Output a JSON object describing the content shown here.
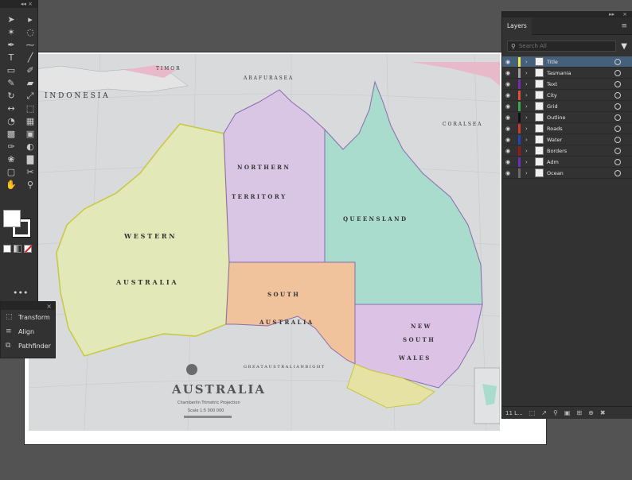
{
  "tools": {
    "panel_controls": "◂◂  ×",
    "icons": [
      "selection-icon",
      "direct-selection-icon",
      "magic-wand-icon",
      "lasso-icon",
      "pen-icon",
      "curvature-icon",
      "type-icon",
      "line-segment-icon",
      "rectangle-icon",
      "paintbrush-icon",
      "shaper-icon",
      "eraser-icon",
      "rotate-icon",
      "scale-icon",
      "width-icon",
      "free-transform-icon",
      "shape-builder-icon",
      "perspective-grid-icon",
      "mesh-icon",
      "gradient-icon",
      "eyedropper-icon",
      "blend-icon",
      "symbol-sprayer-icon",
      "column-graph-icon",
      "artboard-icon",
      "slice-icon",
      "hand-icon",
      "zoom-icon"
    ],
    "more": "•••"
  },
  "float_panel": {
    "items": [
      {
        "label": "Transform",
        "icon": "transform-icon"
      },
      {
        "label": "Align",
        "icon": "align-icon"
      },
      {
        "label": "Pathfinder",
        "icon": "pathfinder-icon"
      }
    ]
  },
  "layers": {
    "tab_label": "Layers",
    "search_placeholder": "Search All",
    "items": [
      {
        "name": "Title",
        "color": "#f4e842",
        "selected": true
      },
      {
        "name": "Tasmania",
        "color": "#a0a0a0",
        "selected": false
      },
      {
        "name": "Text",
        "color": "#7b2ab0",
        "selected": false
      },
      {
        "name": "City",
        "color": "#e24c3b",
        "selected": false
      },
      {
        "name": "Grid",
        "color": "#3aa84a",
        "selected": false
      },
      {
        "name": "Outline",
        "color": "#111111",
        "selected": false
      },
      {
        "name": "Roads",
        "color": "#d33a2a",
        "selected": false
      },
      {
        "name": "Water",
        "color": "#1f45c4",
        "selected": false
      },
      {
        "name": "Borders",
        "color": "#9a1a1a",
        "selected": false
      },
      {
        "name": "Adm",
        "color": "#6b2fb8",
        "selected": false
      },
      {
        "name": "Ocean",
        "color": "#6a6a6a",
        "selected": false
      }
    ],
    "footer_count": "11 L..."
  },
  "map": {
    "title": "AUSTRALIA",
    "subtitle": "Chamberlin Trimetric Projection",
    "scale": "Scale 1:5 000 000",
    "labels": {
      "indonesia": "I N D O N E S I A",
      "timor": "T I M O R",
      "arafura": "A R A F U R A   S E A",
      "coral": "C O R A L   S E A",
      "nt1": "N O R T H E R N",
      "nt2": "T E R R I T O R Y",
      "qld": "Q U E E N S L A N D",
      "wa1": "W E S T E R N",
      "wa2": "A U S T R A L I A",
      "sa1": "S O U T H",
      "sa2": "A U S T R A L I A",
      "nsw1": "N E W",
      "nsw2": "S O U T H",
      "nsw3": "W A L E S",
      "gab": "G R E A T   A U S T R A L I A N   B I G H T"
    },
    "colors": {
      "wa": "#e3e8b8",
      "nt": "#d9c6e4",
      "qld": "#a9dccd",
      "sa": "#f0c39c",
      "nsw": "#dcc3e6",
      "vic": "#e6e2a4",
      "sea": "#d8dadb",
      "border_wa": "#c8c840",
      "border_state": "#8a6bb0"
    }
  }
}
